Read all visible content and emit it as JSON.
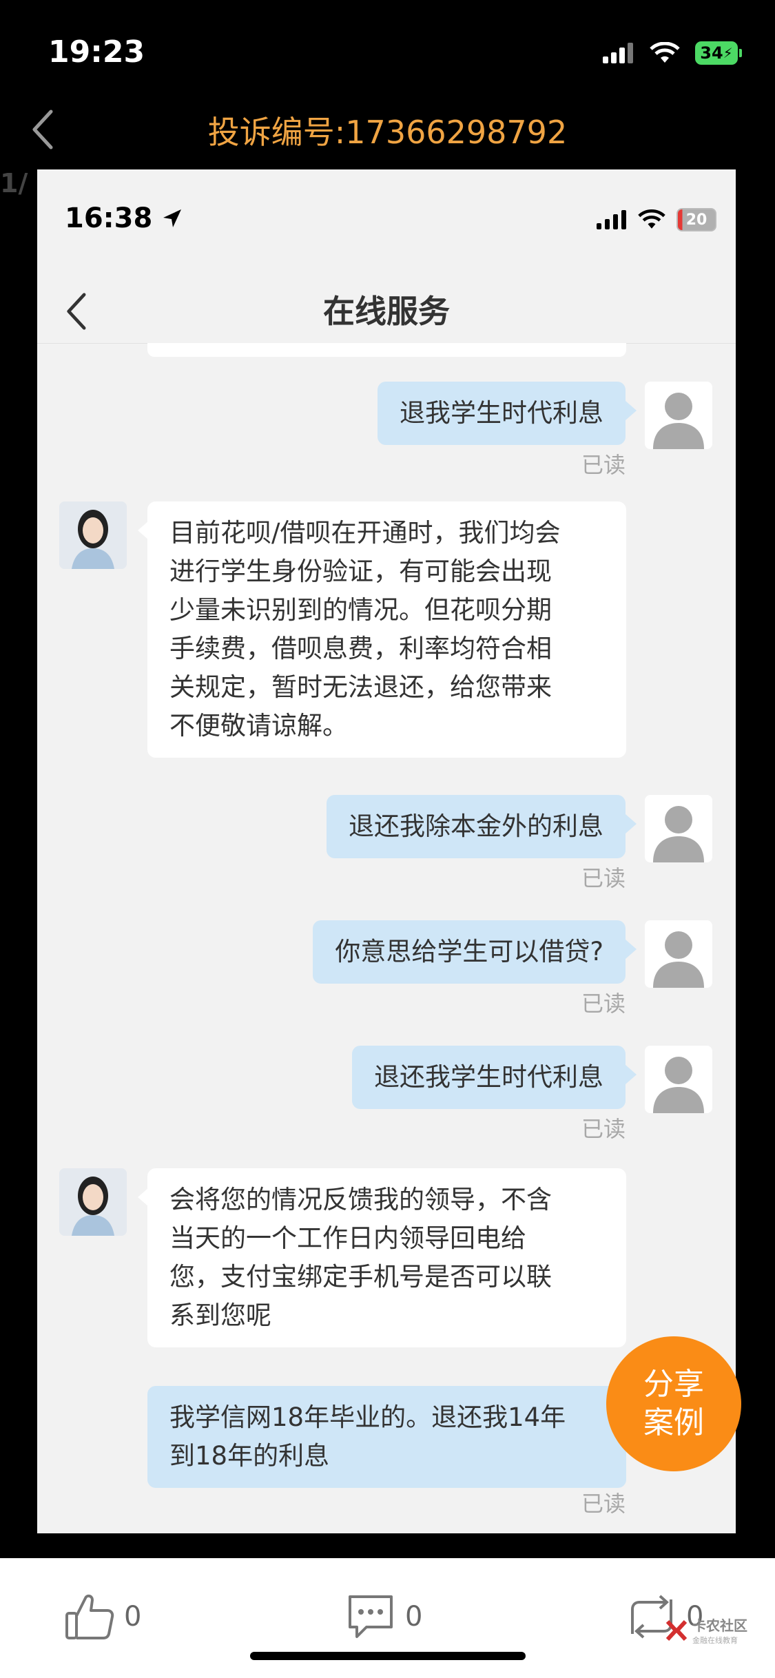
{
  "status_bar": {
    "time": "19:23",
    "battery": "34"
  },
  "header": {
    "title": "投诉编号:17366298792",
    "page_indicator": "1/"
  },
  "inner": {
    "time": "16:38",
    "battery": "20",
    "title": "在线服务",
    "messages": [
      {
        "from": "user",
        "text": "退我学生时代利息",
        "status": "已读"
      },
      {
        "from": "agent",
        "lines": [
          "目前花呗/借呗在开通时，我们均会",
          "进行学生身份验证，有可能会出现",
          "少量未识别到的情况。但花呗分期",
          "手续费，借呗息费，利率均符合相",
          "关规定，暂时无法退还，给您带来",
          "不便敬请谅解。"
        ]
      },
      {
        "from": "user",
        "text": "退还我除本金外的利息",
        "status": "已读"
      },
      {
        "from": "user",
        "text": "你意思给学生可以借贷?",
        "status": "已读"
      },
      {
        "from": "user",
        "text": "退还我学生时代利息",
        "status": "已读"
      },
      {
        "from": "agent",
        "lines": [
          "会将您的情况反馈我的领导，不含",
          "当天的一个工作日内领导回电给",
          "您，支付宝绑定手机号是否可以联",
          "系到您呢"
        ]
      },
      {
        "from": "user",
        "lines": [
          "我学信网18年毕业的。退还我14年",
          "到18年的利息"
        ],
        "status": "已读"
      }
    ]
  },
  "share_button": {
    "line1": "分享",
    "line2": "案例"
  },
  "actions": {
    "like_count": "0",
    "comment_count": "0",
    "repost_count": "0"
  },
  "watermark": {
    "name": "卡农社区",
    "sub": "金融在线教育"
  }
}
